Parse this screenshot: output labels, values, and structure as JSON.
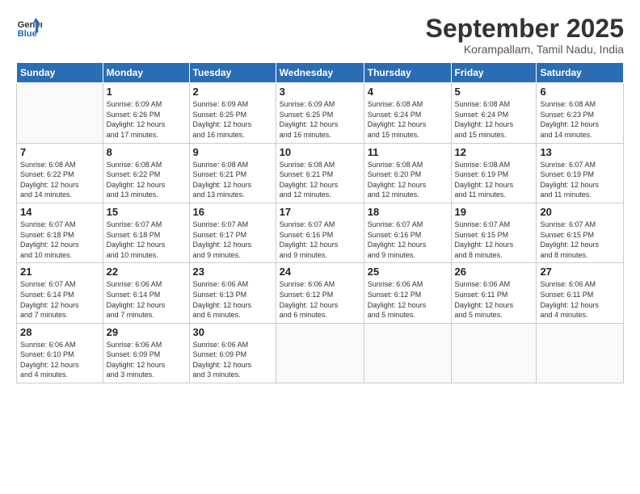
{
  "logo": {
    "line1": "General",
    "line2": "Blue"
  },
  "title": "September 2025",
  "subtitle": "Korampallam, Tamil Nadu, India",
  "days_header": [
    "Sunday",
    "Monday",
    "Tuesday",
    "Wednesday",
    "Thursday",
    "Friday",
    "Saturday"
  ],
  "weeks": [
    [
      {
        "num": "",
        "info": ""
      },
      {
        "num": "1",
        "info": "Sunrise: 6:09 AM\nSunset: 6:26 PM\nDaylight: 12 hours\nand 17 minutes."
      },
      {
        "num": "2",
        "info": "Sunrise: 6:09 AM\nSunset: 6:25 PM\nDaylight: 12 hours\nand 16 minutes."
      },
      {
        "num": "3",
        "info": "Sunrise: 6:09 AM\nSunset: 6:25 PM\nDaylight: 12 hours\nand 16 minutes."
      },
      {
        "num": "4",
        "info": "Sunrise: 6:08 AM\nSunset: 6:24 PM\nDaylight: 12 hours\nand 15 minutes."
      },
      {
        "num": "5",
        "info": "Sunrise: 6:08 AM\nSunset: 6:24 PM\nDaylight: 12 hours\nand 15 minutes."
      },
      {
        "num": "6",
        "info": "Sunrise: 6:08 AM\nSunset: 6:23 PM\nDaylight: 12 hours\nand 14 minutes."
      }
    ],
    [
      {
        "num": "7",
        "info": "Sunrise: 6:08 AM\nSunset: 6:22 PM\nDaylight: 12 hours\nand 14 minutes."
      },
      {
        "num": "8",
        "info": "Sunrise: 6:08 AM\nSunset: 6:22 PM\nDaylight: 12 hours\nand 13 minutes."
      },
      {
        "num": "9",
        "info": "Sunrise: 6:08 AM\nSunset: 6:21 PM\nDaylight: 12 hours\nand 13 minutes."
      },
      {
        "num": "10",
        "info": "Sunrise: 6:08 AM\nSunset: 6:21 PM\nDaylight: 12 hours\nand 12 minutes."
      },
      {
        "num": "11",
        "info": "Sunrise: 6:08 AM\nSunset: 6:20 PM\nDaylight: 12 hours\nand 12 minutes."
      },
      {
        "num": "12",
        "info": "Sunrise: 6:08 AM\nSunset: 6:19 PM\nDaylight: 12 hours\nand 11 minutes."
      },
      {
        "num": "13",
        "info": "Sunrise: 6:07 AM\nSunset: 6:19 PM\nDaylight: 12 hours\nand 11 minutes."
      }
    ],
    [
      {
        "num": "14",
        "info": "Sunrise: 6:07 AM\nSunset: 6:18 PM\nDaylight: 12 hours\nand 10 minutes."
      },
      {
        "num": "15",
        "info": "Sunrise: 6:07 AM\nSunset: 6:18 PM\nDaylight: 12 hours\nand 10 minutes."
      },
      {
        "num": "16",
        "info": "Sunrise: 6:07 AM\nSunset: 6:17 PM\nDaylight: 12 hours\nand 9 minutes."
      },
      {
        "num": "17",
        "info": "Sunrise: 6:07 AM\nSunset: 6:16 PM\nDaylight: 12 hours\nand 9 minutes."
      },
      {
        "num": "18",
        "info": "Sunrise: 6:07 AM\nSunset: 6:16 PM\nDaylight: 12 hours\nand 9 minutes."
      },
      {
        "num": "19",
        "info": "Sunrise: 6:07 AM\nSunset: 6:15 PM\nDaylight: 12 hours\nand 8 minutes."
      },
      {
        "num": "20",
        "info": "Sunrise: 6:07 AM\nSunset: 6:15 PM\nDaylight: 12 hours\nand 8 minutes."
      }
    ],
    [
      {
        "num": "21",
        "info": "Sunrise: 6:07 AM\nSunset: 6:14 PM\nDaylight: 12 hours\nand 7 minutes."
      },
      {
        "num": "22",
        "info": "Sunrise: 6:06 AM\nSunset: 6:14 PM\nDaylight: 12 hours\nand 7 minutes."
      },
      {
        "num": "23",
        "info": "Sunrise: 6:06 AM\nSunset: 6:13 PM\nDaylight: 12 hours\nand 6 minutes."
      },
      {
        "num": "24",
        "info": "Sunrise: 6:06 AM\nSunset: 6:12 PM\nDaylight: 12 hours\nand 6 minutes."
      },
      {
        "num": "25",
        "info": "Sunrise: 6:06 AM\nSunset: 6:12 PM\nDaylight: 12 hours\nand 5 minutes."
      },
      {
        "num": "26",
        "info": "Sunrise: 6:06 AM\nSunset: 6:11 PM\nDaylight: 12 hours\nand 5 minutes."
      },
      {
        "num": "27",
        "info": "Sunrise: 6:06 AM\nSunset: 6:11 PM\nDaylight: 12 hours\nand 4 minutes."
      }
    ],
    [
      {
        "num": "28",
        "info": "Sunrise: 6:06 AM\nSunset: 6:10 PM\nDaylight: 12 hours\nand 4 minutes."
      },
      {
        "num": "29",
        "info": "Sunrise: 6:06 AM\nSunset: 6:09 PM\nDaylight: 12 hours\nand 3 minutes."
      },
      {
        "num": "30",
        "info": "Sunrise: 6:06 AM\nSunset: 6:09 PM\nDaylight: 12 hours\nand 3 minutes."
      },
      {
        "num": "",
        "info": ""
      },
      {
        "num": "",
        "info": ""
      },
      {
        "num": "",
        "info": ""
      },
      {
        "num": "",
        "info": ""
      }
    ]
  ]
}
